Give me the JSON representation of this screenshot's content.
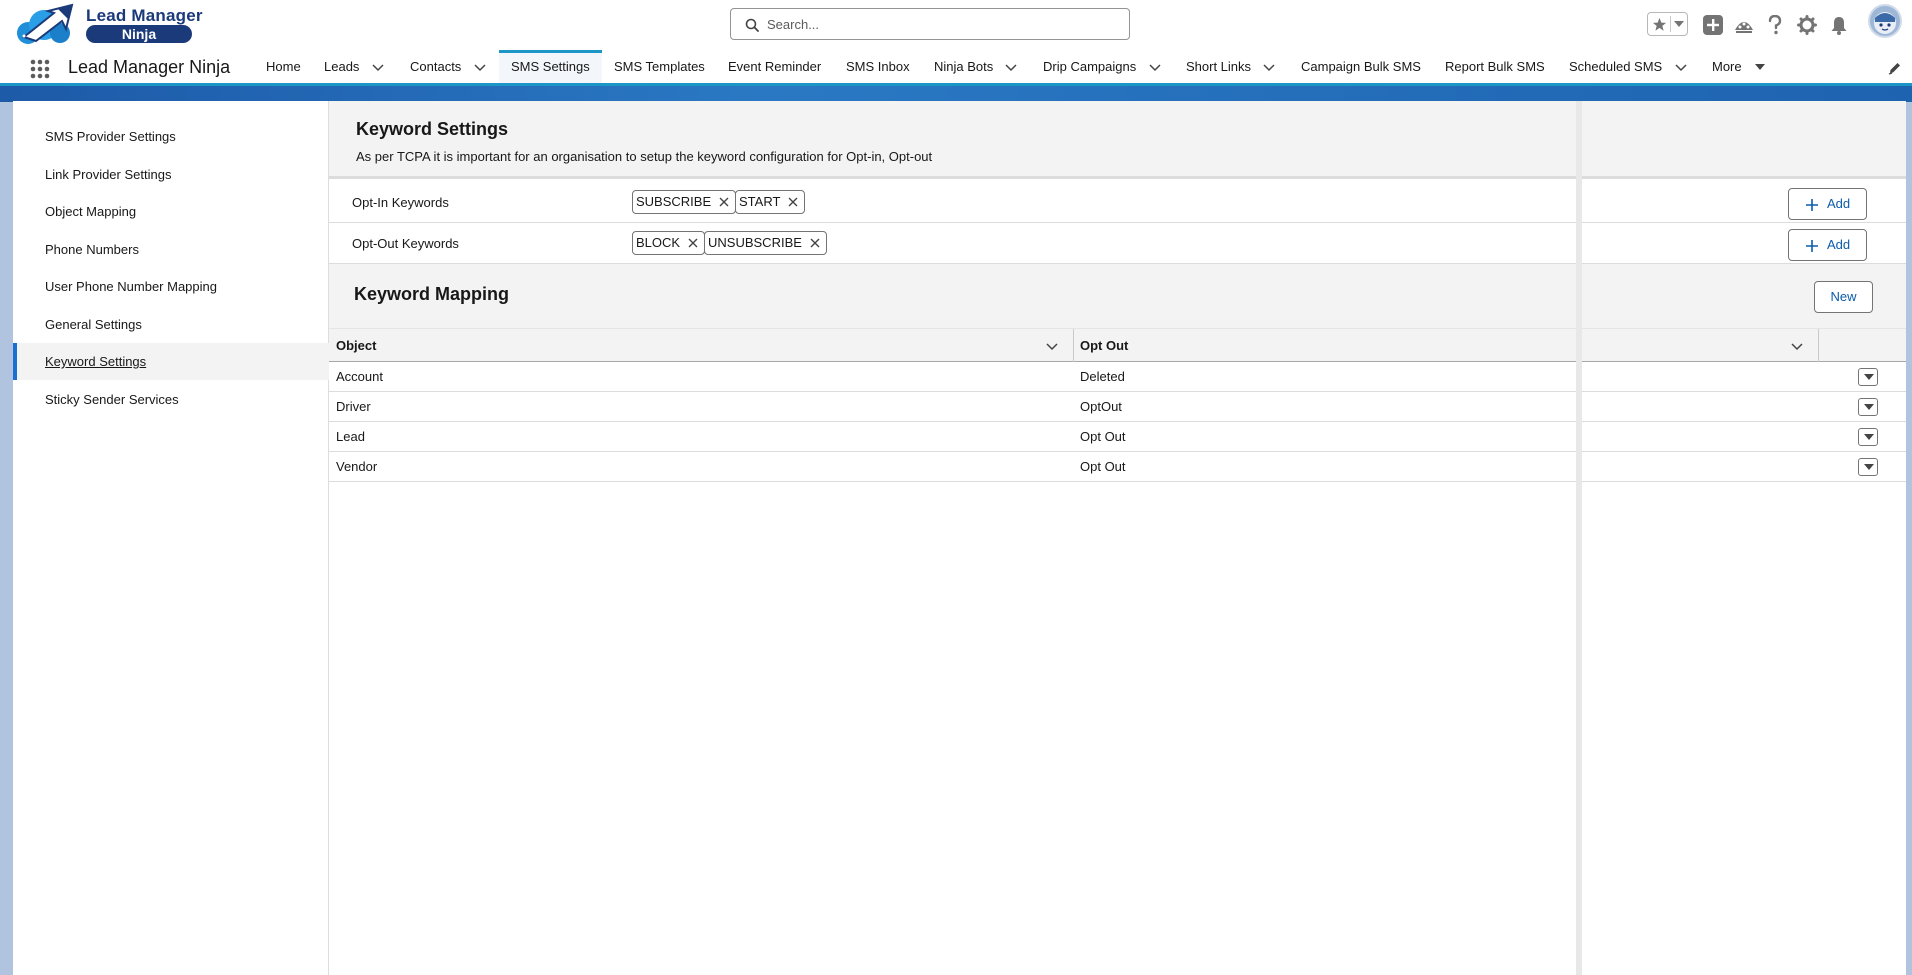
{
  "header": {
    "brand_top": "Lead Manager",
    "brand_badge": "Ninja",
    "search_placeholder": "Search...",
    "icons": [
      "star-icon",
      "chevron-down-icon",
      "add-icon",
      "trailhead-icon",
      "help-icon",
      "gear-icon",
      "bell-icon",
      "avatar"
    ]
  },
  "nav": {
    "app_name": "Lead Manager Ninja",
    "items": [
      {
        "label": "Home",
        "has_menu": false
      },
      {
        "label": "Leads",
        "has_menu": true
      },
      {
        "label": "Contacts",
        "has_menu": true
      },
      {
        "label": "SMS Settings",
        "has_menu": false,
        "active": true
      },
      {
        "label": "SMS Templates",
        "has_menu": false
      },
      {
        "label": "Event Reminder",
        "has_menu": false
      },
      {
        "label": "SMS Inbox",
        "has_menu": false
      },
      {
        "label": "Ninja Bots",
        "has_menu": true
      },
      {
        "label": "Drip Campaigns",
        "has_menu": true
      },
      {
        "label": "Short Links",
        "has_menu": true
      },
      {
        "label": "Campaign Bulk SMS",
        "has_menu": false
      },
      {
        "label": "Report Bulk SMS",
        "has_menu": false
      },
      {
        "label": "Scheduled SMS",
        "has_menu": true
      },
      {
        "label": "More",
        "has_menu": true
      }
    ]
  },
  "sidebar": {
    "items": [
      {
        "label": "SMS Provider Settings"
      },
      {
        "label": "Link Provider Settings"
      },
      {
        "label": "Object Mapping"
      },
      {
        "label": "Phone Numbers"
      },
      {
        "label": "User Phone Number Mapping"
      },
      {
        "label": "General Settings"
      },
      {
        "label": "Keyword Settings",
        "active": true
      },
      {
        "label": "Sticky Sender Services"
      }
    ]
  },
  "keyword_settings": {
    "title": "Keyword Settings",
    "description": "As per TCPA it is important for an organisation to setup the keyword configuration for Opt-in, Opt-out",
    "opt_in": {
      "label": "Opt-In Keywords",
      "keywords": [
        "SUBSCRIBE",
        "START"
      ],
      "add_label": "Add"
    },
    "opt_out": {
      "label": "Opt-Out Keywords",
      "keywords": [
        "BLOCK",
        "UNSUBSCRIBE"
      ],
      "add_label": "Add"
    }
  },
  "keyword_mapping": {
    "title": "Keyword Mapping",
    "new_label": "New",
    "columns": [
      "Object",
      "Opt Out"
    ],
    "rows": [
      {
        "object": "Account",
        "opt_out": "Deleted"
      },
      {
        "object": "Driver",
        "opt_out": "OptOut"
      },
      {
        "object": "Lead",
        "opt_out": "Opt Out"
      },
      {
        "object": "Vendor",
        "opt_out": "Opt Out"
      }
    ]
  },
  "colors": {
    "accent": "#1b96c7",
    "brand": "#1b3a7a",
    "link": "#0b5cab",
    "active_indicator": "#1b6fd1"
  }
}
